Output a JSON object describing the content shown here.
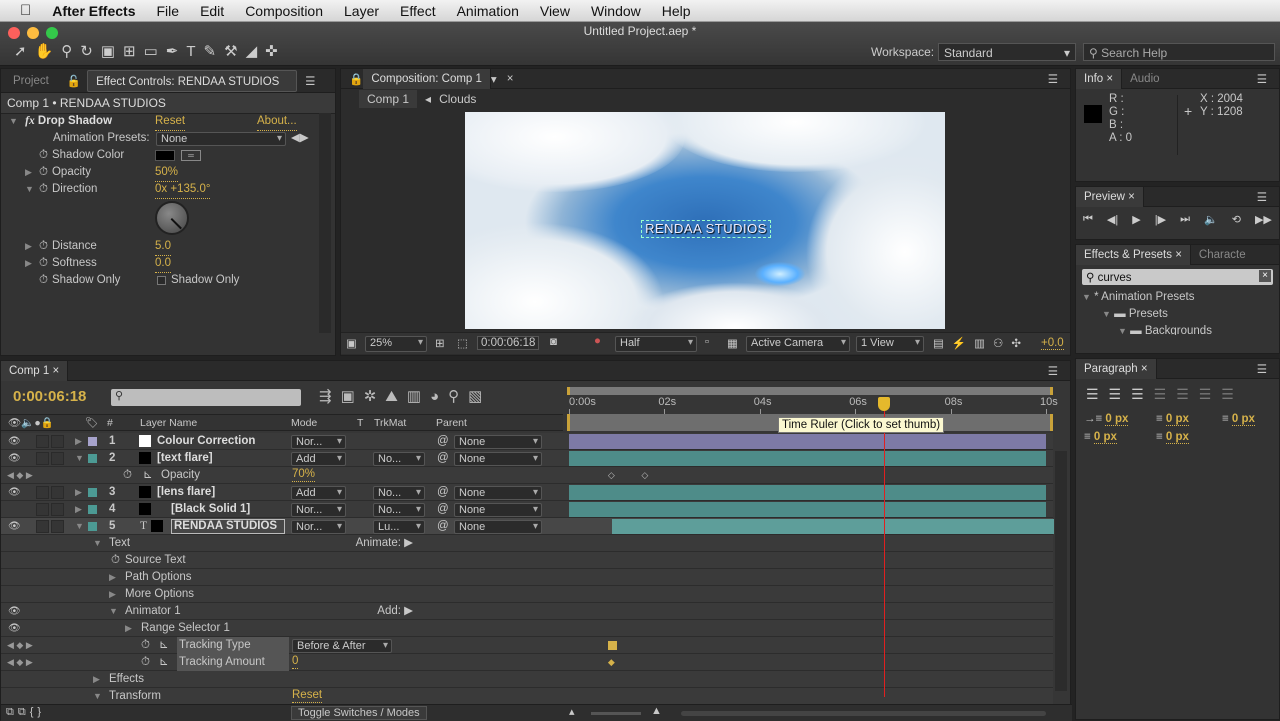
{
  "menubar": {
    "app": "After Effects",
    "items": [
      "File",
      "Edit",
      "Composition",
      "Layer",
      "Effect",
      "Animation",
      "View",
      "Window",
      "Help"
    ]
  },
  "window": {
    "title": "Untitled Project.aep *"
  },
  "toolbar": {
    "workspace_label": "Workspace:",
    "workspace_value": "Standard",
    "search_placeholder": "Search Help"
  },
  "left_panel": {
    "tab_project": "Project",
    "tab_effect": "Effect Controls: RENDAA STUDIOS",
    "breadcrumb": "Comp 1 • RENDAA STUDIOS",
    "effect_name": "Drop Shadow",
    "reset": "Reset",
    "about": "About...",
    "presets_label": "Animation Presets:",
    "presets_value": "None",
    "props": [
      {
        "label": "Shadow Color",
        "value": ""
      },
      {
        "label": "Opacity",
        "value": "50%"
      },
      {
        "label": "Direction",
        "value": "0x +135.0°"
      },
      {
        "label": "Distance",
        "value": "5.0"
      },
      {
        "label": "Softness",
        "value": "0.0"
      },
      {
        "label": "Shadow Only",
        "value": "Shadow Only"
      }
    ]
  },
  "comp_panel": {
    "tab": "Composition: Comp 1",
    "crumb_comp": "Comp 1",
    "crumb_next": "Clouds",
    "overlay_text": "RENDAA STUDIOS",
    "zoom": "25%",
    "timecode": "0:00:06:18",
    "resolution": "Half",
    "camera": "Active Camera",
    "views": "1 View",
    "exposure": "+0.0"
  },
  "info": {
    "tab": "Info",
    "tab2": "Audio",
    "r": "R :",
    "g": "G :",
    "b": "B :",
    "a": "A : 0",
    "x": "X : 2004",
    "y": "Y : 1208"
  },
  "preview": {
    "tab": "Preview"
  },
  "effects_presets": {
    "tab": "Effects & Presets",
    "tab2": "Characte",
    "search": "curves",
    "tree": [
      "* Animation Presets",
      "Presets",
      "Backgrounds"
    ]
  },
  "paragraph": {
    "tab": "Paragraph",
    "values": [
      "0 px",
      "0 px",
      "0 px",
      "0 px",
      "0 px"
    ]
  },
  "timeline": {
    "tab": "Comp 1",
    "timecode": "0:00:06:18",
    "headers": {
      "name": "Layer Name",
      "mode": "Mode",
      "t": "T",
      "trkmat": "TrkMat",
      "parent": "Parent",
      "num": "#"
    },
    "ruler": [
      "0:00s",
      "02s",
      "04s",
      "06s",
      "08s",
      "10s"
    ],
    "tooltip": "Time Ruler (Click to set thumb)",
    "toggle": "Toggle Switches / Modes",
    "current_time_seconds": 6.6,
    "duration_seconds": 10,
    "layers": [
      {
        "num": "1",
        "name": "Colour Correction",
        "mode": "Nor...",
        "trkmat": "",
        "parent": "None",
        "color": "#a7a3cc",
        "swatch": "#ffffff",
        "open": false,
        "eye": true,
        "bar": "#7d7aa6",
        "start": 0
      },
      {
        "num": "2",
        "name": "[text flare]",
        "mode": "Add",
        "trkmat": "No...",
        "parent": "None",
        "color": "#4c9a94",
        "swatch": "#000000",
        "open": true,
        "eye": true,
        "bar": "#4e8c89",
        "start": 0
      },
      {
        "prop": "Opacity",
        "value": "70%",
        "indent": 1,
        "keys": [
          0.9,
          1.6
        ]
      },
      {
        "num": "3",
        "name": "[lens flare]",
        "mode": "Add",
        "trkmat": "No...",
        "parent": "None",
        "color": "#4c9a94",
        "swatch": "#000000",
        "open": false,
        "eye": true,
        "bar": "#4e8c89",
        "start": 0
      },
      {
        "num": "4",
        "name": "[Black Solid 1]",
        "mode": "Nor...",
        "trkmat": "No...",
        "parent": "None",
        "color": "#4c9a94",
        "swatch": "#000000",
        "open": false,
        "eye": false,
        "bar": "#4e8c89",
        "start": 0
      },
      {
        "num": "5",
        "name": "RENDAA STUDIOS",
        "mode": "Nor...",
        "trkmat": "Lu...",
        "parent": "None",
        "color": "#4c9a94",
        "swatch": "#000000",
        "open": true,
        "eye": true,
        "bar": "#5e9e9a",
        "start": 0.9,
        "selected": true
      }
    ],
    "props": [
      {
        "label": "Text",
        "tri": "down",
        "lvl": 0,
        "right": "Animate:"
      },
      {
        "label": "Source Text",
        "tri": "",
        "lvl": 1,
        "stopwatch": true
      },
      {
        "label": "Path Options",
        "tri": "right",
        "lvl": 1
      },
      {
        "label": "More Options",
        "tri": "right",
        "lvl": 1
      },
      {
        "label": "Animator 1",
        "tri": "down",
        "lvl": 1,
        "right": "Add:",
        "eye": true
      },
      {
        "label": "Range Selector 1",
        "tri": "right",
        "lvl": 2,
        "eye": true
      },
      {
        "label": "Tracking Type",
        "lvl": 3,
        "value": "Before & After",
        "dropdown": true,
        "nav": true,
        "key": "square"
      },
      {
        "label": "Tracking Amount",
        "lvl": 3,
        "value": "0",
        "nav": true,
        "key": "diamond"
      },
      {
        "label": "Effects",
        "tri": "right",
        "lvl": 0
      },
      {
        "label": "Transform",
        "tri": "down",
        "lvl": 0,
        "value": "Reset"
      }
    ]
  }
}
